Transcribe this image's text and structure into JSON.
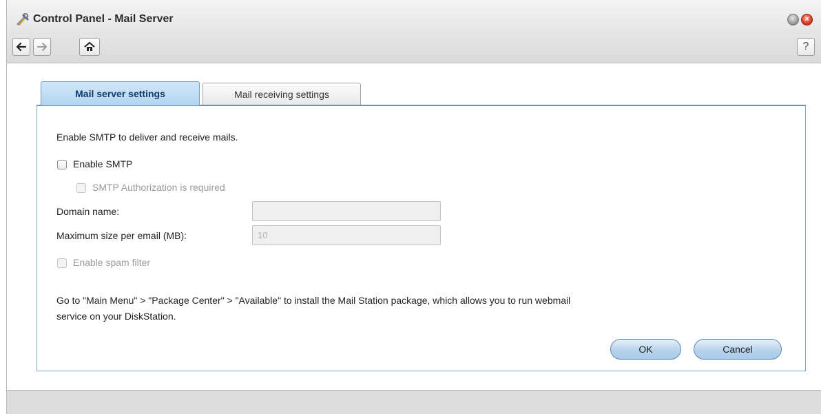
{
  "window": {
    "title": "Control Panel - Mail Server",
    "app_icon": "wrench-screwdriver-icon",
    "close_glyph": "×"
  },
  "toolbar": {
    "back_icon": "arrow-left-icon",
    "forward_icon": "arrow-right-icon",
    "home_icon": "home-icon",
    "help_label": "?"
  },
  "tabs": [
    {
      "label": "Mail server settings",
      "active": true
    },
    {
      "label": "Mail receiving settings",
      "active": false
    }
  ],
  "settings": {
    "intro": "Enable SMTP to deliver and receive mails.",
    "enable_smtp": {
      "label": "Enable SMTP",
      "checked": false
    },
    "smtp_auth": {
      "label": "SMTP Authorization is required",
      "checked": false,
      "disabled": true
    },
    "domain": {
      "label": "Domain name:",
      "value": ""
    },
    "max_size": {
      "label": "Maximum size per email (MB):",
      "value": "10"
    },
    "spam_filter": {
      "label": "Enable spam filter",
      "checked": false,
      "disabled": true
    },
    "note_line1": "Go to \"Main Menu\" > \"Package Center\" > \"Available\" to install the Mail Station package, which allows you to run webmail",
    "note_line2": "service on your DiskStation."
  },
  "buttons": {
    "ok": "OK",
    "cancel": "Cancel"
  },
  "colors": {
    "accent": "#b1d4ef",
    "active_tab_text": "#0f3a6e",
    "close_button": "#d9341d"
  }
}
